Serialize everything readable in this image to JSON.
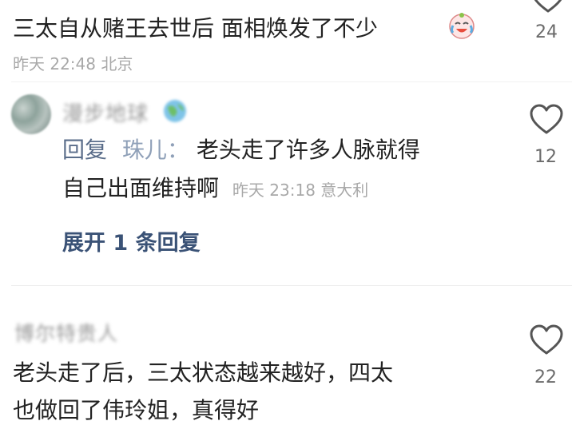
{
  "comment1": {
    "text": "三太自从赌王去世后 面相焕发了不少",
    "emoji_icon": "crying-laughing-face-icon",
    "meta": "昨天 22:48 北京",
    "likes": "24"
  },
  "comment2": {
    "username": "漫步地球",
    "reply_label": "回复",
    "reply_target": "珠儿：",
    "text_line1": "老头走了许多人脉就得",
    "text_line2": "自己出面维持啊",
    "meta": "昨天 23:18 意大利",
    "likes": "12",
    "expand_label": "展开 1 条回复"
  },
  "comment3": {
    "username": "博尔特贵人",
    "text_line1": "老头走了后，三太状态越来越好，四太",
    "text_line2": "也做回了伟玲姐，真得好",
    "likes": "22"
  },
  "colors": {
    "text": "#222222",
    "meta": "#a8a8a8",
    "link": "#3a5276",
    "heart": "#555555"
  }
}
